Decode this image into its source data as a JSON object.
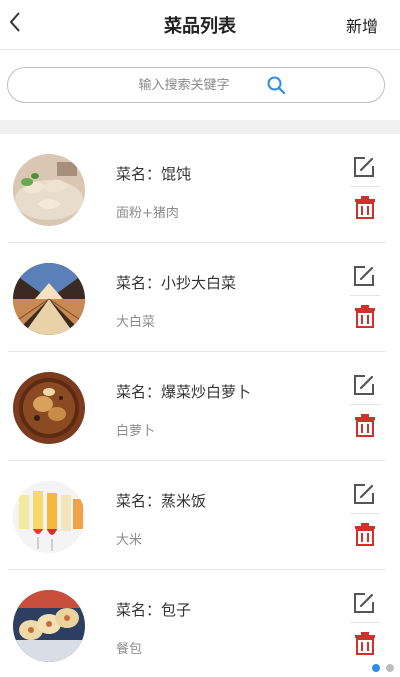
{
  "header": {
    "title": "菜品列表",
    "add_label": "新增",
    "back_icon": "chevron-left-icon"
  },
  "search": {
    "placeholder": "输入搜索关键字",
    "value": "",
    "icon": "search-icon",
    "icon_color": "#2f8de4"
  },
  "colors": {
    "delete": "#d0312d",
    "edit": "#555555",
    "dot_active": "#2f8de4",
    "dot_inactive": "#bdbdbd"
  },
  "dishes": [
    {
      "name_prefix": "菜名：",
      "name": "馄饨",
      "ingredients": "面粉+猪肉",
      "image_icon": "wonton-photo"
    },
    {
      "name_prefix": "菜名：",
      "name": "小抄大白菜",
      "ingredients": "大白菜",
      "image_icon": "cabbage-photo"
    },
    {
      "name_prefix": "菜名：",
      "name": "爆菜炒白萝卜",
      "ingredients": "白萝卜",
      "image_icon": "radish-photo"
    },
    {
      "name_prefix": "菜名：",
      "name": "蒸米饭",
      "ingredients": "大米",
      "image_icon": "drinks-photo"
    },
    {
      "name_prefix": "菜名：",
      "name": "包子",
      "ingredients": "餐包",
      "image_icon": "buns-photo"
    }
  ],
  "pagination": {
    "total": 2,
    "active": 0
  }
}
